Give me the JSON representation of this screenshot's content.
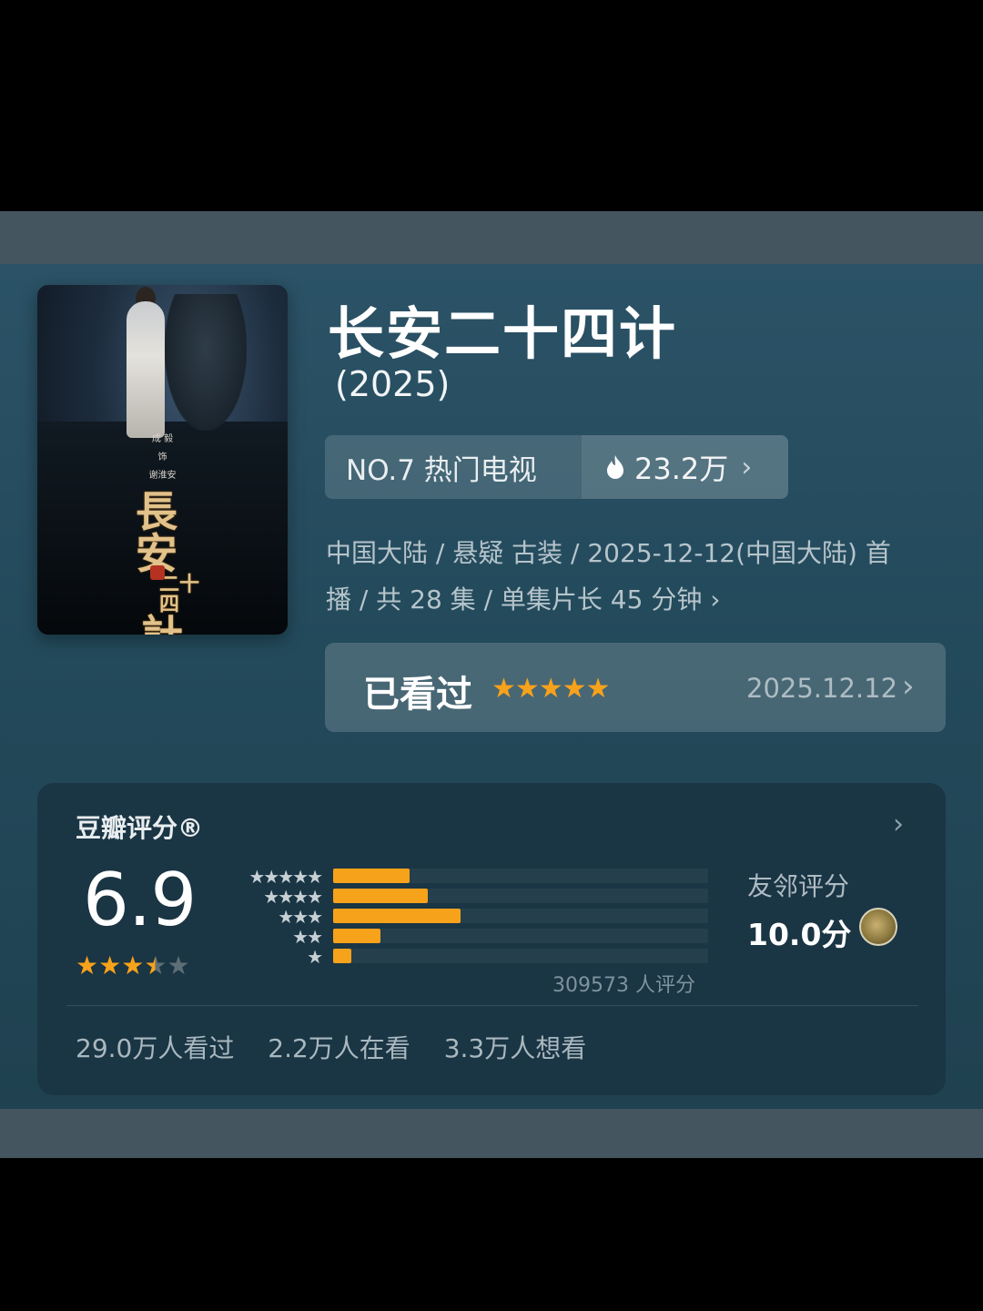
{
  "poster": {
    "credits": [
      "成 毅",
      "饰",
      "谢淮安"
    ],
    "calligraphy": [
      "長安",
      "二十四",
      "計"
    ]
  },
  "movie": {
    "title": "长安二十四计",
    "year": "(2025)"
  },
  "rank": {
    "label": "NO.7 热门电视",
    "heat": "23.2万",
    "heat_icon": "flame-icon"
  },
  "meta": {
    "line1": "中国大陆 / 悬疑 古装 / 2025-12-12(中国大陆) 首",
    "line2": "播 / 共 28 集 / 单集片长 45 分钟"
  },
  "watched": {
    "label": "已看过",
    "stars": 5,
    "date": "2025.12.12"
  },
  "rating": {
    "title": "豆瓣评分®",
    "score": "6.9",
    "stars_value": 3.5,
    "distribution": [
      {
        "stars": "★★★★★",
        "fraction": 0.21
      },
      {
        "stars": "★★★★",
        "fraction": 0.26
      },
      {
        "stars": "★★★",
        "fraction": 0.35
      },
      {
        "stars": "★★",
        "fraction": 0.13
      },
      {
        "stars": "★",
        "fraction": 0.05
      }
    ],
    "raters": "309573 人评分",
    "friends_label": "友邻评分",
    "friends_score": "10.0分"
  },
  "stats": {
    "watched": "29.0万人看过",
    "watching": "2.2万人在看",
    "wish": "3.3万人想看"
  },
  "colors": {
    "accent": "#f7a21b",
    "panel": "#234a5b",
    "card": "#1a3544"
  }
}
